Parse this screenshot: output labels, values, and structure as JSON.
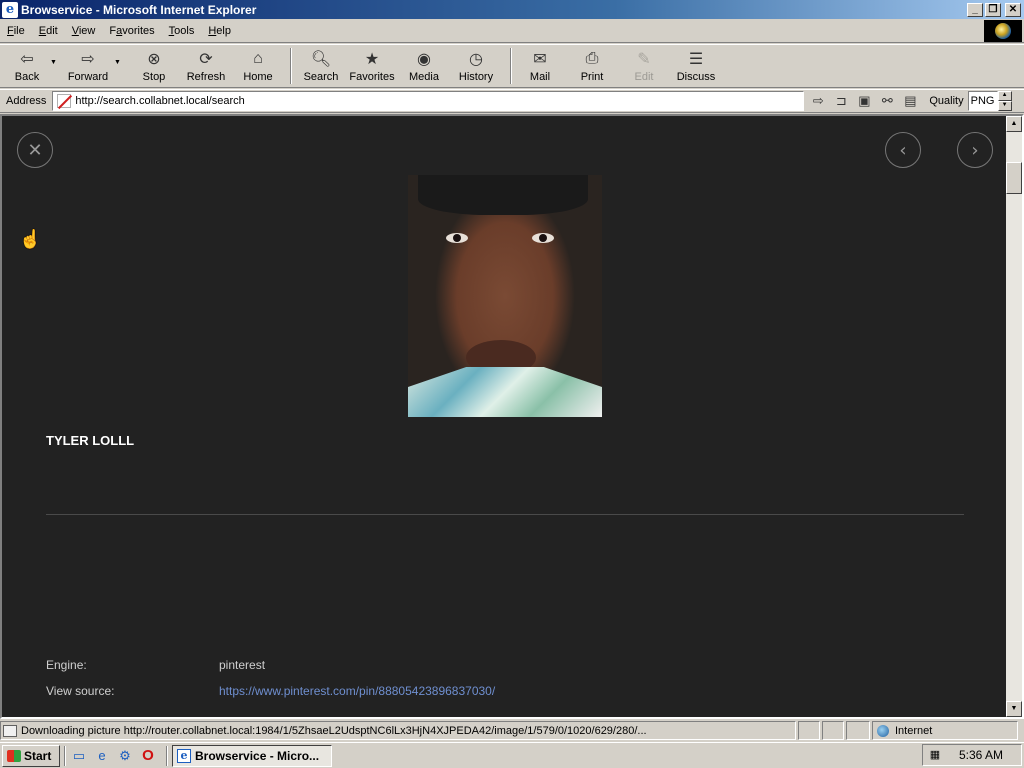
{
  "window": {
    "title": "Browservice - Microsoft Internet Explorer"
  },
  "menu": [
    "File",
    "Edit",
    "View",
    "Favorites",
    "Tools",
    "Help"
  ],
  "menu_accel": [
    "F",
    "E",
    "V",
    "a",
    "T",
    "H"
  ],
  "toolbar": {
    "back": "Back",
    "forward": "Forward",
    "stop": "Stop",
    "refresh": "Refresh",
    "home": "Home",
    "search": "Search",
    "favorites": "Favorites",
    "media": "Media",
    "history": "History",
    "mail": "Mail",
    "print": "Print",
    "edit": "Edit",
    "discuss": "Discuss"
  },
  "address": {
    "label": "Address",
    "url": "http://search.collabnet.local/search",
    "quality_label": "Quality",
    "quality_value": "PNG"
  },
  "content": {
    "title": "TYLER LOLLL",
    "engine_label": "Engine:",
    "engine_value": "pinterest",
    "source_label": "View source:",
    "source_value": "https://www.pinterest.com/pin/888054238968370​30/"
  },
  "status": {
    "text": "Downloading picture http://router.collabnet.local:1984/1/5ZhsaeL2UdsptNC6lLx3HjN4XJPEDA42/image/1/579/0/1020/629/280/...",
    "zone": "Internet"
  },
  "taskbar": {
    "start": "Start",
    "task": "Browservice - Micro...",
    "clock": "5:36 AM"
  },
  "colors": {
    "content_bg": "#222222",
    "link": "#6f8fd0",
    "titlebar": "#0a246a"
  }
}
